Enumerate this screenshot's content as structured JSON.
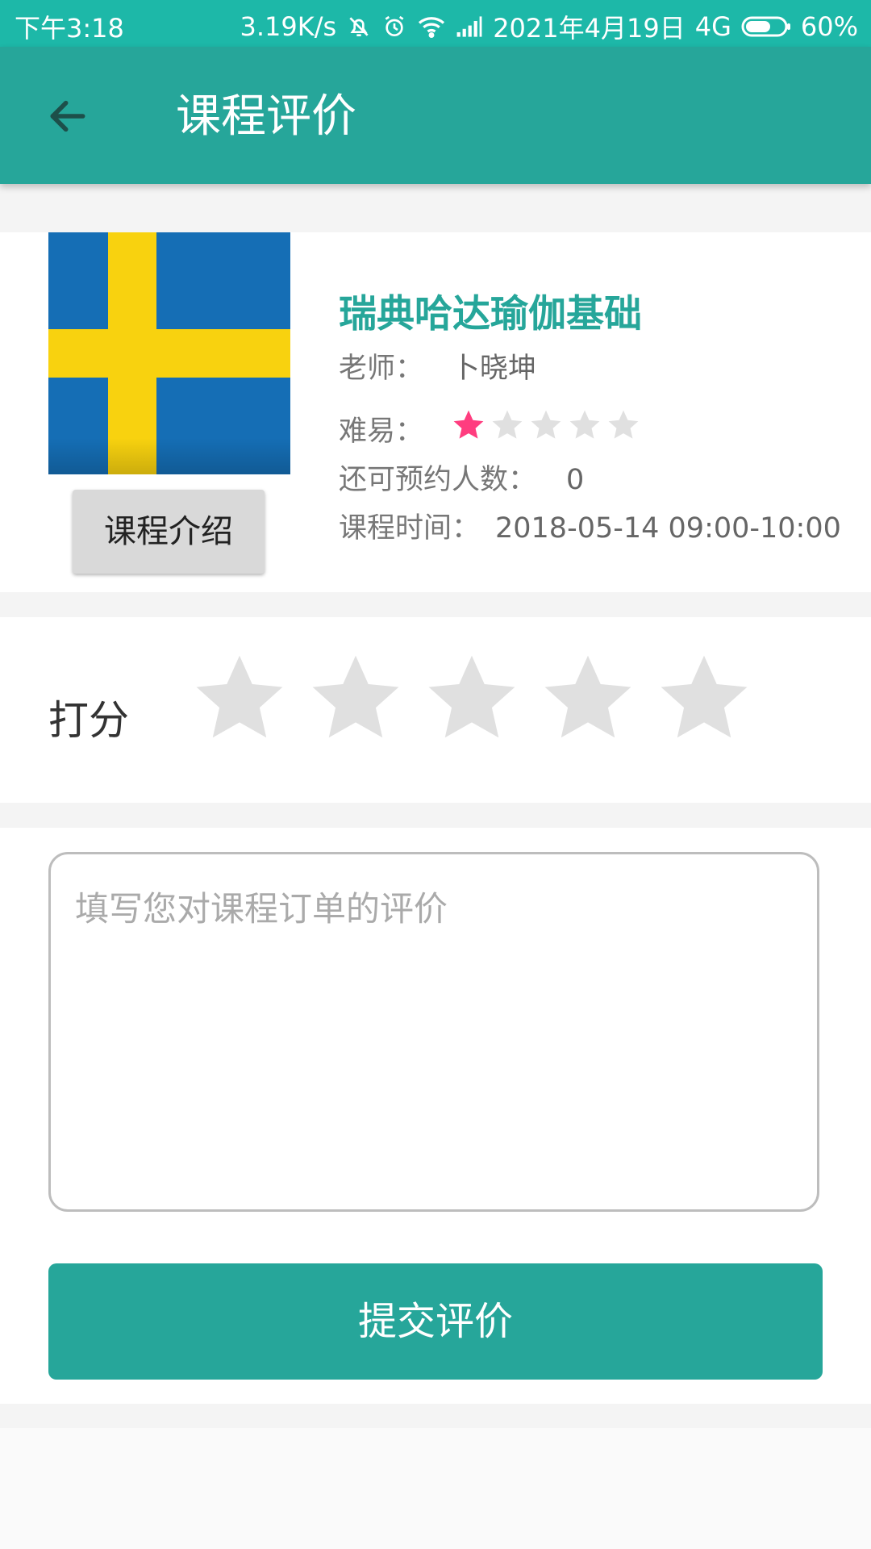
{
  "status_bar": {
    "time": "下午3:18",
    "net_speed": "3.19K/s",
    "date": "2021年4月19日",
    "network": "4G",
    "battery": "60%"
  },
  "toolbar": {
    "back_icon": "arrow-left-icon",
    "title": "课程评价"
  },
  "course": {
    "image_icon": "sweden-flag",
    "intro_button": "课程介绍",
    "name": "瑞典哈达瑜伽基础",
    "teacher_label": "老师：",
    "teacher": "卜晓坤",
    "difficulty_label": "难易：",
    "difficulty_rating": 1,
    "difficulty_max": 5,
    "available_label": "还可预约人数：",
    "available": "0",
    "time_label": "课程时间：",
    "time": "2018-05-14 09:00-10:00"
  },
  "rating": {
    "label": "打分",
    "value": 0,
    "max": 5
  },
  "review": {
    "placeholder": "填写您对课程订单的评价",
    "value": ""
  },
  "submit_button": "提交评价",
  "colors": {
    "status_bar": "#1db8a8",
    "primary": "#26a69a",
    "star_active": "#ff3d7f",
    "star_inactive": "#e0e0e0"
  }
}
